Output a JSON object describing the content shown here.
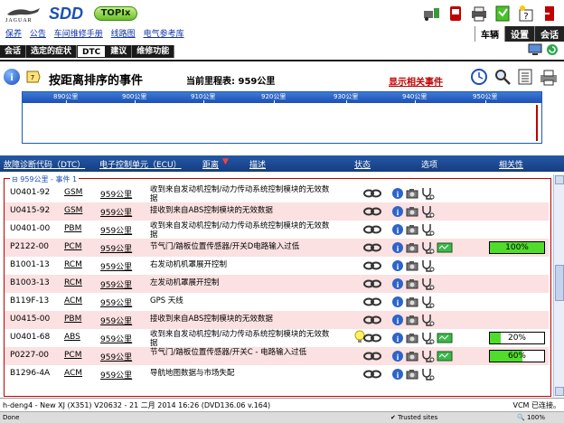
{
  "brand": {
    "jaguar": "JAGUAR",
    "sdd": "SDD",
    "topix": "TOPIx"
  },
  "top_nav": [
    "保养",
    "公告",
    "车间维修手册",
    "线路图",
    "电气参考库"
  ],
  "right_tabs": [
    "车辆",
    "设置",
    "会话"
  ],
  "sub_tabs": [
    "会话",
    "选定的症状",
    "DTC",
    "建议",
    "维修功能"
  ],
  "title": {
    "text": "按距离排序的事件",
    "mileage": "当前里程表: 959公里",
    "show_related": "显示相关事件"
  },
  "timeline": {
    "ticks": [
      "890公里",
      "900公里",
      "910公里",
      "920公里",
      "930公里",
      "940公里",
      "950公里"
    ]
  },
  "columns": {
    "dtc": "故障诊断代码（DTC）",
    "ecu": "电子控制单元（ECU）",
    "distance": "距离",
    "description": "描述",
    "status": "状态",
    "options": "选项",
    "relevance": "相关性"
  },
  "group": "959公里 - 事件 1",
  "events": [
    {
      "code": "U0401-92",
      "ecu": "GSM",
      "dist": "959公里",
      "desc": "收到来自发动机控制/动力传动系统控制模块的无效数据",
      "rel": null,
      "bulb": false
    },
    {
      "code": "U0415-92",
      "ecu": "GSM",
      "dist": "959公里",
      "desc": "接收到来自ABS控制模块的无效数据",
      "rel": null,
      "bulb": false
    },
    {
      "code": "U0401-00",
      "ecu": "PBM",
      "dist": "959公里",
      "desc": "收到来自发动机控制/动力传动系统控制模块的无效数据",
      "rel": null,
      "bulb": false
    },
    {
      "code": "P2122-00",
      "ecu": "PCM",
      "dist": "959公里",
      "desc": "节气门/踏板位置传感器/开关D电路输入过低",
      "rel": 100,
      "rel_label": "100%",
      "bulb": false
    },
    {
      "code": "B1001-13",
      "ecu": "RCM",
      "dist": "959公里",
      "desc": "右发动机机罩展开控制",
      "rel": null,
      "bulb": false
    },
    {
      "code": "B1003-13",
      "ecu": "RCM",
      "dist": "959公里",
      "desc": "左发动机罩展开控制",
      "rel": null,
      "bulb": false
    },
    {
      "code": "B119F-13",
      "ecu": "ACM",
      "dist": "959公里",
      "desc": "GPS 天线",
      "rel": null,
      "bulb": false
    },
    {
      "code": "U0415-00",
      "ecu": "PBM",
      "dist": "959公里",
      "desc": "接收到来自ABS控制模块的无效数据",
      "rel": null,
      "bulb": false
    },
    {
      "code": "U0401-68",
      "ecu": "ABS",
      "dist": "959公里",
      "desc": "收到来自发动机控制/动力传动系统控制模块的无效数据",
      "rel": 20,
      "rel_label": "20%",
      "bulb": true
    },
    {
      "code": "P0227-00",
      "ecu": "PCM",
      "dist": "959公里",
      "desc": "节气门/踏板位置传感器/开关C - 电路输入过低",
      "rel": 60,
      "rel_label": "60%",
      "bulb": false
    },
    {
      "code": "B1296-4A",
      "ecu": "ACM",
      "dist": "959公里",
      "desc": "导航地图数据与市场失配",
      "rel": null,
      "bulb": false
    }
  ],
  "footer": {
    "left": "h-deng4 - New XJ (X351) V20632 - 21 二月 2014 16:26 (DVD136.06 v.164)",
    "right": "VCM 已连接。"
  },
  "statusbar": {
    "done": "Done",
    "trusted": "Trusted sites",
    "zoom": "100%"
  },
  "colors": {
    "brand_blue": "#1d4fb6",
    "header_blue": "#2458a8",
    "alt_row": "#fbe1e1",
    "rel_fill": "#4fdc2a",
    "alert_red": "#c00000"
  }
}
